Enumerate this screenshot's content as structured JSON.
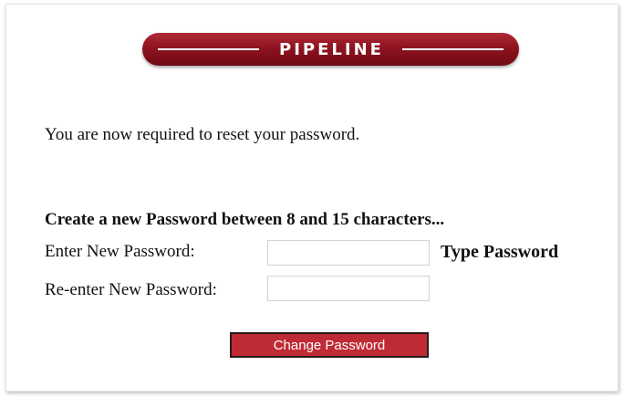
{
  "banner": {
    "title": "PIPELINE"
  },
  "intro_text": "You are now required to reset your password.",
  "form": {
    "heading": "Create a new Password between 8 and 15 characters...",
    "new_password": {
      "label": "Enter New Password:",
      "value": "",
      "placeholder": "",
      "hint": "Type Password"
    },
    "confirm_password": {
      "label": "Re-enter New Password:",
      "value": "",
      "placeholder": ""
    },
    "submit_label": "Change Password"
  },
  "colors": {
    "banner_red": "#8e1320",
    "button_red": "#bf2b34",
    "button_border": "#2a1a1a"
  }
}
